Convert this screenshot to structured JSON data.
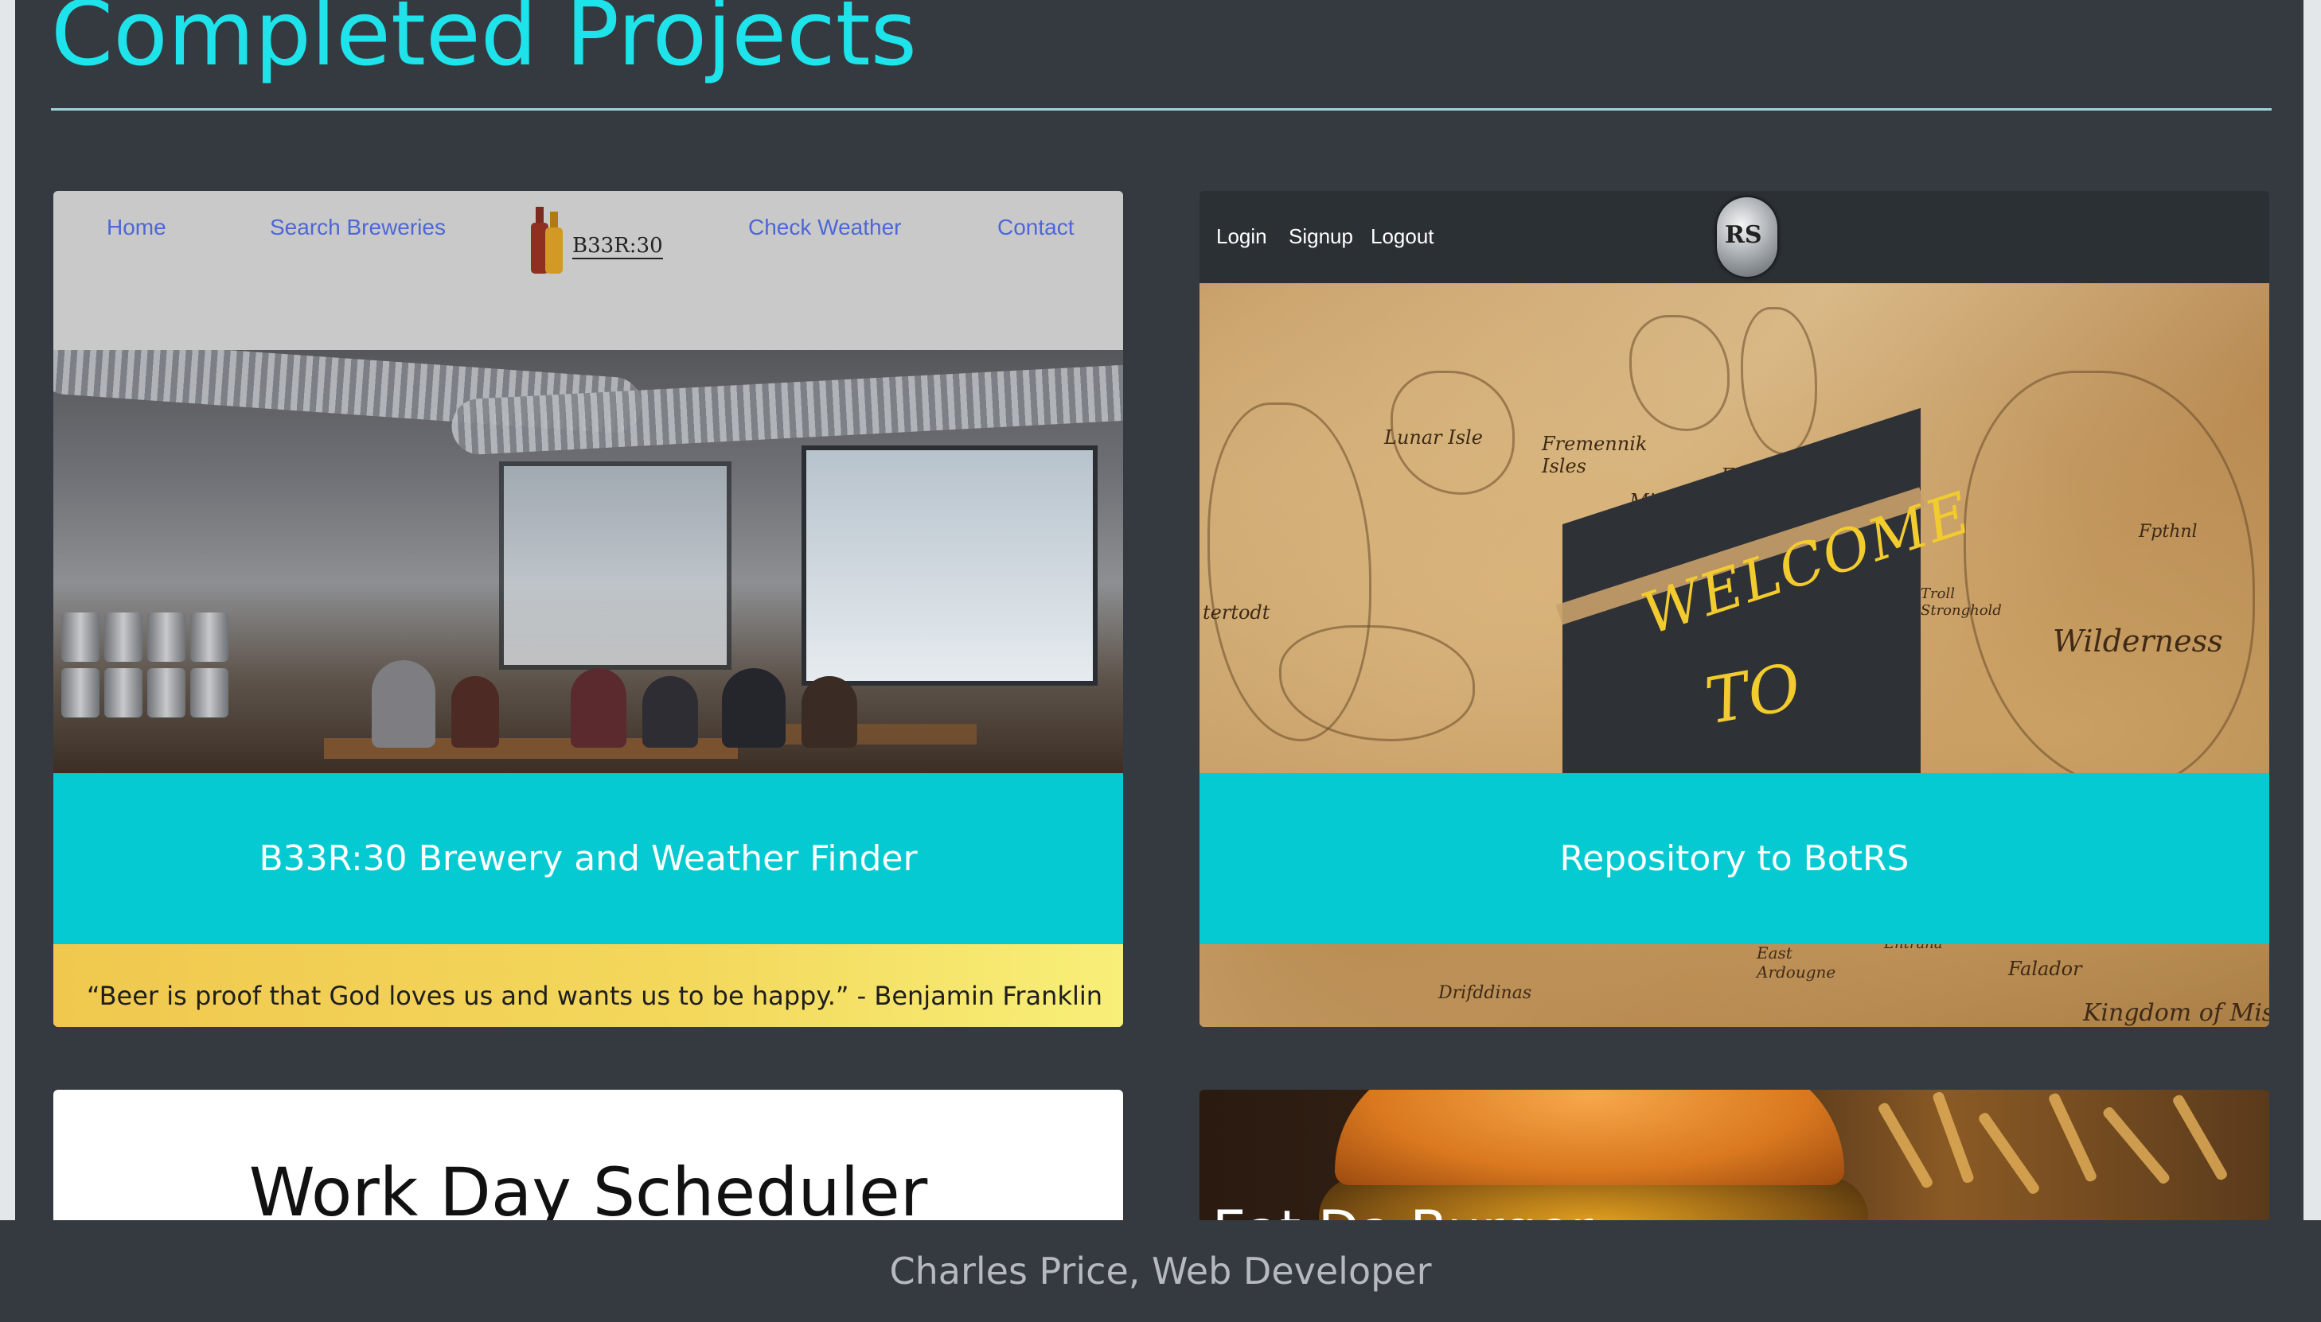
{
  "page": {
    "heading": "Completed Projects",
    "colors": {
      "heading": "#1ee3ea",
      "background": "#343a40",
      "banner": "#06cad2"
    }
  },
  "projects": [
    {
      "nav": {
        "links": [
          "Home",
          "Search Breweries",
          "Check Weather",
          "Contact"
        ],
        "brand": "B33R:30"
      },
      "title": "B33R:30 Brewery and Weather Finder",
      "quote": "“Beer is proof that God loves us and wants us to be happy.” - Benjamin Franklin"
    },
    {
      "nav": {
        "links": [
          "Login",
          "Signup",
          "Logout"
        ],
        "logo": "RS"
      },
      "map_labels": [
        "Lunar Isle",
        "Fremennik Isles",
        "Miscella",
        "Etceter",
        "tertodt",
        "Wilderness",
        "Troll Stronghold",
        "Fpthnl",
        "East Ardougne",
        "Entrana",
        "Falador",
        "Drifddinas",
        "Kingdom of Misthal"
      ],
      "sign": {
        "line1": "WELCOME",
        "line2": "TO"
      },
      "title": "Repository to BotRS"
    },
    {
      "title": "Work Day Scheduler"
    },
    {
      "title": "Eat Da Burger"
    }
  ],
  "footer": {
    "text": "Charles Price, Web Developer"
  }
}
